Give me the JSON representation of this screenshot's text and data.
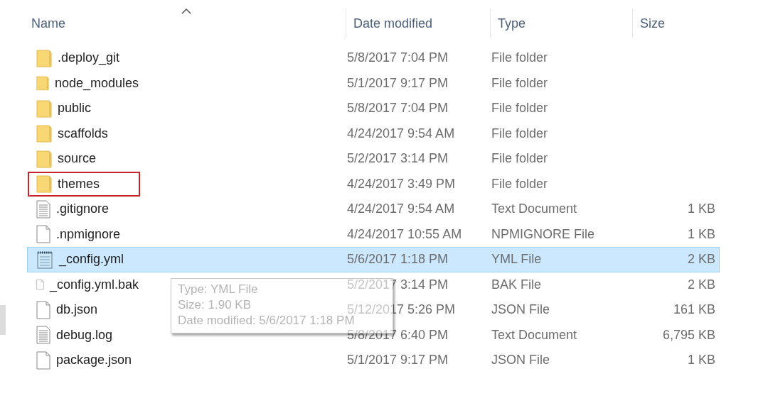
{
  "columns": [
    {
      "label": "Name",
      "sorted": true
    },
    {
      "label": "Date modified",
      "sorted": false
    },
    {
      "label": "Type",
      "sorted": false
    },
    {
      "label": "Size",
      "sorted": false
    }
  ],
  "rows": [
    {
      "kind": "folder",
      "name": ".deploy_git",
      "date": "5/8/2017 7:04 PM",
      "type": "File folder",
      "selected": false,
      "annotated": false
    },
    {
      "kind": "folder",
      "name": "node_modules",
      "date": "5/1/2017 9:17 PM",
      "type": "File folder",
      "selected": false,
      "annotated": false
    },
    {
      "kind": "folder",
      "name": "public",
      "date": "5/8/2017 7:04 PM",
      "type": "File folder",
      "selected": false,
      "annotated": false
    },
    {
      "kind": "folder",
      "name": "scaffolds",
      "date": "4/24/2017 9:54 AM",
      "type": "File folder",
      "selected": false,
      "annotated": false
    },
    {
      "kind": "folder",
      "name": "source",
      "date": "5/2/2017 3:14 PM",
      "type": "File folder",
      "selected": false,
      "annotated": false
    },
    {
      "kind": "folder",
      "name": "themes",
      "date": "4/24/2017 3:49 PM",
      "type": "File folder",
      "selected": false,
      "annotated": true
    },
    {
      "kind": "text",
      "name": ".gitignore",
      "date": "4/24/2017 9:54 AM",
      "type": "Text Document",
      "size": "1 KB",
      "selected": false,
      "annotated": false
    },
    {
      "kind": "blank",
      "name": ".npmignore",
      "date": "4/24/2017 10:55 AM",
      "type": "NPMIGNORE File",
      "size": "1 KB",
      "selected": false,
      "annotated": false
    },
    {
      "kind": "notepad",
      "name": "_config.yml",
      "date": "5/6/2017 1:18 PM",
      "type": "YML File",
      "size": "2 KB",
      "selected": true,
      "annotated": false
    },
    {
      "kind": "blank",
      "name": "_config.yml.bak",
      "date": "5/2/2017 3:14 PM",
      "type": "BAK File",
      "size": "2 KB",
      "selected": false,
      "annotated": false
    },
    {
      "kind": "blank",
      "name": "db.json",
      "date": "5/12/2017 5:26 PM",
      "type": "JSON File",
      "size": "161 KB",
      "selected": false,
      "annotated": false
    },
    {
      "kind": "text",
      "name": "debug.log",
      "date": "5/8/2017 6:40 PM",
      "type": "Text Document",
      "size": "6,795 KB",
      "selected": false,
      "annotated": false
    },
    {
      "kind": "blank",
      "name": "package.json",
      "date": "5/1/2017 9:17 PM",
      "type": "JSON File",
      "size": "1 KB",
      "selected": false,
      "annotated": false
    }
  ],
  "tooltip": {
    "lines": [
      "Type: YML File",
      "Size: 1.90 KB",
      "Date modified: 5/6/2017 1:18 PM"
    ]
  }
}
